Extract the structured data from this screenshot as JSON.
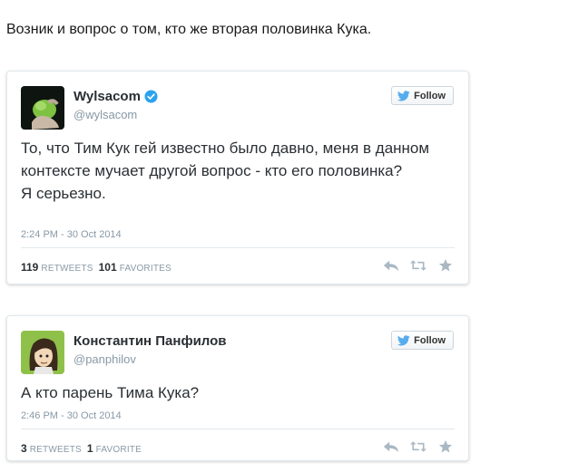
{
  "intro_text": "Возник и вопрос о том, кто же вторая половинка Кука.",
  "colors": {
    "follow_bird": "#55acee",
    "verified_badge": "#2aa3ef",
    "action_icon": "#aab8c2"
  },
  "tweets": [
    {
      "author": {
        "name": "Wylsacom",
        "handle": "@wylsacom",
        "verified": true,
        "avatar": "green-hand-avatar"
      },
      "follow_label": "Follow",
      "text_lines": [
        "То, что Тим Кук гей известно было давно, меня в данном контексте мучает другой вопрос - кто его половинка?",
        "Я серьезно."
      ],
      "date": "2:24 PM - 30 Oct 2014",
      "retweets": {
        "count": "119",
        "label": "RETWEETS"
      },
      "favorites": {
        "count": "101",
        "label": "FAVORITES"
      }
    },
    {
      "author": {
        "name": "Константин Панфилов",
        "handle": "@panphilov",
        "verified": false,
        "avatar": "cartoon-boy-avatar"
      },
      "follow_label": "Follow",
      "text_lines": [
        "А кто парень Тима Кука?"
      ],
      "date": "2:46 PM - 30 Oct 2014",
      "retweets": {
        "count": "3",
        "label": "RETWEETS"
      },
      "favorites": {
        "count": "1",
        "label": "FAVORITE"
      }
    }
  ]
}
